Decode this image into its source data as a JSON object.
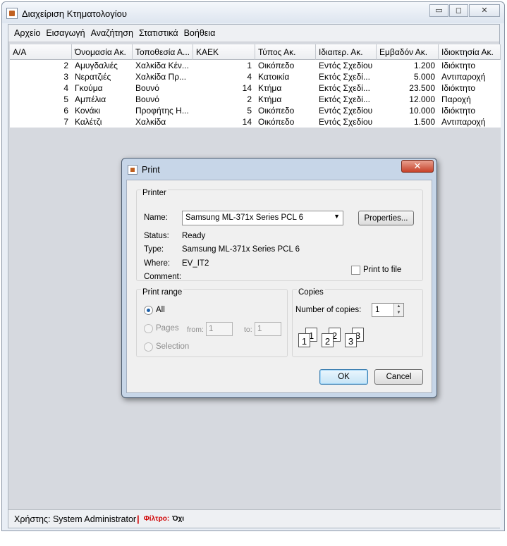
{
  "window": {
    "title": "Διαχείριση Κτηματολογίου",
    "controls": {
      "minimize": "▭",
      "maximize": "◻",
      "close": "✕"
    }
  },
  "menubar": {
    "items": [
      "Αρχείο",
      "Εισαγωγή",
      "Αναζήτηση",
      "Στατιστικά",
      "Βοήθεια"
    ]
  },
  "table": {
    "columns": [
      "Α/Α",
      "Όνομασία Ακ.",
      "Τοποθεσία Α...",
      "ΚΑΕΚ",
      "Τύπος Ακ.",
      "Ιδιαιτερ. Ακ.",
      "Εμβαδόν Ακ.",
      "Ιδιοκτησία Ακ."
    ],
    "rows": [
      [
        "2",
        "Αμυγδαλιές",
        "Χαλκίδα Κέν...",
        "1",
        "Οικόπεδο",
        "Εντός Σχεδίου",
        "1.200",
        "Ιδιόκτητο"
      ],
      [
        "3",
        "Νερατζιές",
        "Χαλκίδα Πρ...",
        "4",
        "Κατοικία",
        "Εκτός Σχεδί...",
        "5.000",
        "Αντιπαροχή"
      ],
      [
        "4",
        "Γκούμα",
        "Βουνό",
        "14",
        "Κτήμα",
        "Εκτός Σχεδί...",
        "23.500",
        "Ιδιόκτητο"
      ],
      [
        "5",
        "Αμπέλια",
        "Βουνό",
        "2",
        "Κτήμα",
        "Εκτός Σχεδί...",
        "12.000",
        "Παροχή"
      ],
      [
        "6",
        "Κονάκι",
        "Προφήτης Η...",
        "5",
        "Οικόπεδο",
        "Εντός Σχεδίου",
        "10.000",
        "Ιδιόκτητο"
      ],
      [
        "7",
        "Καλέτζι",
        "Χαλκίδα",
        "14",
        "Οικόπεδο",
        "Εντός Σχεδίου",
        "1.500",
        "Αντιπαροχή"
      ]
    ]
  },
  "statusbar": {
    "user": "Χρήστης: System Administrator",
    "separator": "|",
    "filter_label": "Φίλτρο:",
    "filter_value": "Όχι"
  },
  "print_dialog": {
    "title": "Print",
    "close_glyph": "✕",
    "printer_group": "Printer",
    "name_label": "Name:",
    "printer_name": "Samsung ML-371x Series PCL 6",
    "properties_button": "Properties...",
    "status_label": "Status:",
    "status_value": "Ready",
    "type_label": "Type:",
    "type_value": "Samsung ML-371x Series PCL 6",
    "where_label": "Where:",
    "where_value": "EV_IT2",
    "comment_label": "Comment:",
    "print_to_file_label": "Print to file",
    "print_to_file_checked": false,
    "range_group": "Print range",
    "range_all": "All",
    "range_pages": "Pages",
    "range_selection": "Selection",
    "from_label": "from:",
    "from_value": "1",
    "to_label": "to:",
    "to_value": "1",
    "selected_range": "All",
    "copies_group": "Copies",
    "copies_label": "Number of copies:",
    "copies_value": "1",
    "collate_pages": [
      "1",
      "1",
      "2",
      "2",
      "3",
      "3"
    ],
    "ok_button": "OK",
    "cancel_button": "Cancel"
  },
  "colors": {
    "filter_label": "#d00000",
    "dialog_frame": "#c7d6e8",
    "close_button": "#c7422a"
  }
}
